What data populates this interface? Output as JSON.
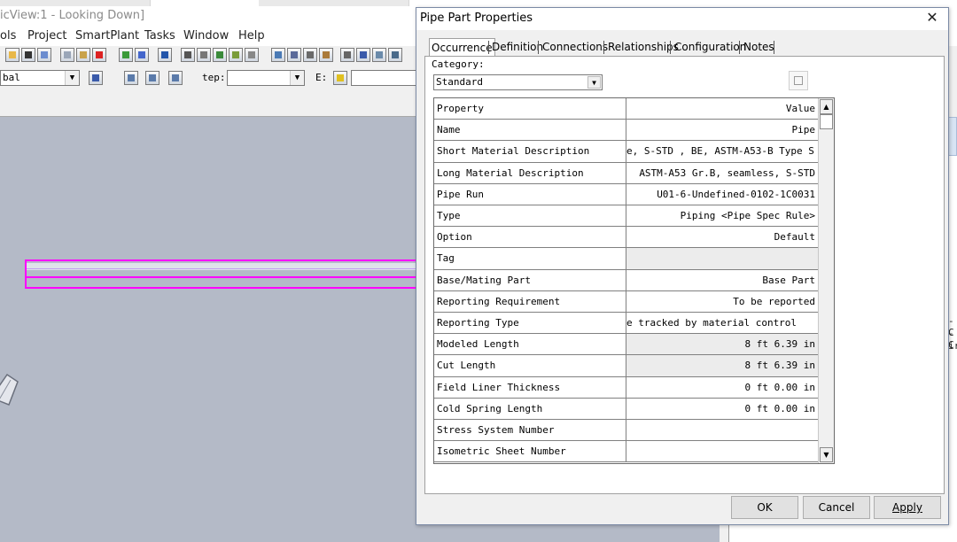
{
  "app": {
    "title": "icView:1 - Looking Down]",
    "menu": [
      "ols",
      "Project",
      "SmartPlant",
      "Tasks",
      "Window",
      "Help"
    ],
    "toolbar": {
      "scope_value": "bal",
      "step_label": "tep:",
      "step_value": "",
      "e_label": "E:",
      "e_value": ""
    },
    "right_panel_snippets": [
      "-C",
      "-C",
      "ir"
    ]
  },
  "dialog": {
    "title": "Pipe Part Properties",
    "close_icon": "close-icon",
    "tabs": [
      "Occurrence",
      "Definition",
      "Connections",
      "Relationships",
      "Configuration",
      "Notes"
    ],
    "active_tab": "Occurrence",
    "category_label": "Category:",
    "category_value": "Standard",
    "grid": {
      "header": {
        "property": "Property",
        "value": "Value"
      },
      "rows": [
        {
          "property": "Name",
          "value": "Pipe",
          "editable": true
        },
        {
          "property": "Short Material Description",
          "value": "e, S-STD , BE, ASTM-A53-B Type S",
          "editable": true
        },
        {
          "property": "Long Material Description",
          "value": "ASTM-A53 Gr.B, seamless, S-STD",
          "editable": true
        },
        {
          "property": "Pipe Run",
          "value": "U01-6-Undefined-0102-1C0031",
          "editable": true
        },
        {
          "property": "Type",
          "value": "Piping <Pipe Spec Rule>",
          "editable": true
        },
        {
          "property": "Option",
          "value": "Default",
          "editable": true
        },
        {
          "property": "Tag",
          "value": "",
          "editable": false
        },
        {
          "property": "Base/Mating Part",
          "value": "Base Part",
          "editable": true
        },
        {
          "property": "Reporting Requirement",
          "value": "To be reported",
          "editable": true
        },
        {
          "property": "Reporting Type",
          "value": "e tracked by material control",
          "editable": true
        },
        {
          "property": "Modeled Length",
          "value": "8 ft  6.39 in",
          "editable": false
        },
        {
          "property": "Cut Length",
          "value": "8 ft  6.39 in",
          "editable": false
        },
        {
          "property": "Field Liner Thickness",
          "value": "0 ft  0.00 in",
          "editable": true
        },
        {
          "property": "Cold Spring Length",
          "value": "0 ft  0.00 in",
          "editable": true
        },
        {
          "property": "Stress System Number",
          "value": "",
          "editable": true
        },
        {
          "property": "Isometric Sheet Number",
          "value": "",
          "editable": true
        }
      ]
    },
    "buttons": {
      "ok": "OK",
      "cancel": "Cancel",
      "apply": "Apply"
    }
  },
  "colors": {
    "pipe_outline": "#ff00ff",
    "viewport_bg": "#b4bac7"
  }
}
